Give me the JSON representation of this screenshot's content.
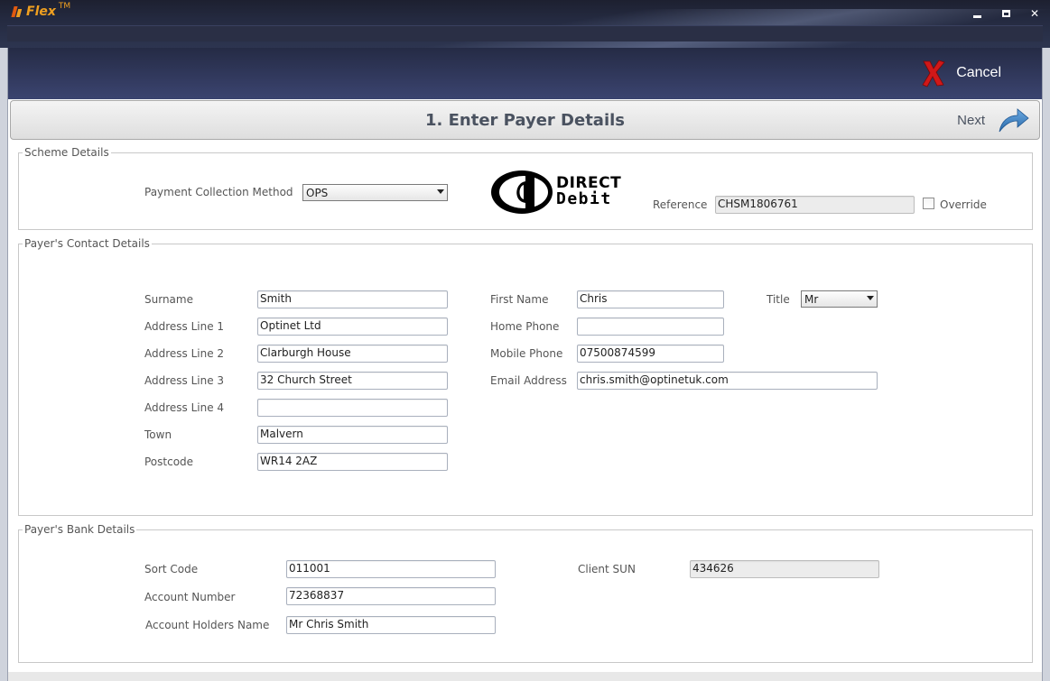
{
  "app": {
    "name": "Flex",
    "trademark": "TM"
  },
  "window_controls": {
    "minimize": "minimize",
    "maximize": "maximize",
    "close": "✕"
  },
  "header": {
    "cancel_label": "Cancel"
  },
  "step": {
    "title": "1. Enter Payer Details",
    "next_label": "Next"
  },
  "scheme": {
    "legend": "Scheme Details",
    "payment_method_label": "Payment Collection Method",
    "payment_method_value": "OPS",
    "logo_line1": "DIRECT",
    "logo_line2": "Debit",
    "reference_label": "Reference",
    "reference_value": "CHSM1806761",
    "override_label": "Override",
    "override_checked": false
  },
  "contact": {
    "legend": "Payer's Contact Details",
    "surname_label": "Surname",
    "surname": "Smith",
    "address1_label": "Address Line 1",
    "address1": "Optinet Ltd",
    "address2_label": "Address Line 2",
    "address2": "Clarburgh House",
    "address3_label": "Address Line 3",
    "address3": "32 Church Street",
    "address4_label": "Address Line 4",
    "address4": "",
    "town_label": "Town",
    "town": "Malvern",
    "postcode_label": "Postcode",
    "postcode": "WR14 2AZ",
    "first_name_label": "First Name",
    "first_name": "Chris",
    "title_label": "Title",
    "title_value": "Mr",
    "home_phone_label": "Home Phone",
    "home_phone": "",
    "mobile_phone_label": "Mobile Phone",
    "mobile_phone": "07500874599",
    "email_label": "Email Address",
    "email": "chris.smith@optinetuk.com"
  },
  "bank": {
    "legend": "Payer's Bank Details",
    "sort_code_label": "Sort Code",
    "sort_code": "011001",
    "account_number_label": "Account Number",
    "account_number": "72368837",
    "holder_label": "Account Holders Name",
    "holder": "Mr Chris Smith",
    "client_sun_label": "Client SUN",
    "client_sun": "434626"
  },
  "colors": {
    "accent": "#f0a020",
    "header": "#2d3550",
    "cancel_red": "#d01818",
    "next_blue": "#3a7fc0"
  }
}
